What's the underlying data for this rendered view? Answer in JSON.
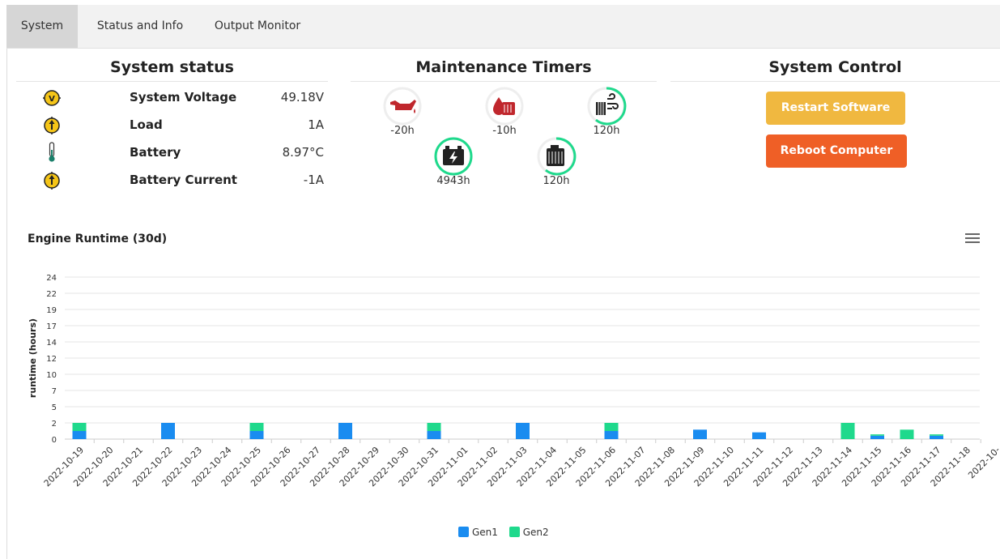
{
  "tabs": [
    {
      "label": "System",
      "active": true
    },
    {
      "label": "Status and Info",
      "active": false
    },
    {
      "label": "Output Monitor",
      "active": false
    }
  ],
  "system_status": {
    "title": "System status",
    "rows": [
      {
        "icon": "voltage-gauge-icon",
        "label": "System Voltage",
        "value": "49.18V"
      },
      {
        "icon": "current-arrow-icon",
        "label": "Load",
        "value": "1A"
      },
      {
        "icon": "thermometer-icon",
        "label": "Battery",
        "value": "8.97°C"
      },
      {
        "icon": "current-arrow-icon",
        "label": "Battery Current",
        "value": "-1A"
      }
    ]
  },
  "maintenance": {
    "title": "Maintenance Timers",
    "timers": [
      {
        "icon": "oil-can-icon",
        "value": "-20h",
        "progress": 0
      },
      {
        "icon": "coolant-drop-icon",
        "value": "-10h",
        "progress": 0
      },
      {
        "icon": "air-filter-icon",
        "value": "120h",
        "progress": 0.6
      },
      {
        "icon": "battery-icon",
        "value": "4943h",
        "progress": 1.0
      },
      {
        "icon": "fuel-filter-icon",
        "value": "120h",
        "progress": 0.6
      }
    ]
  },
  "system_control": {
    "title": "System Control",
    "restart_label": "Restart Software",
    "reboot_label": "Reboot Computer"
  },
  "colors": {
    "gen1": "#1a8cf0",
    "gen2": "#1fd98c",
    "restart": "#f0b840",
    "reboot": "#ef5f26",
    "ring": "#1fd98c",
    "icon_red": "#c0272d"
  },
  "chart_data": {
    "type": "bar",
    "title": "Engine Runtime (30d)",
    "ylabel": "runtime (hours)",
    "ylim": [
      0,
      24
    ],
    "yticks": [
      "0",
      "2",
      "5",
      "7",
      "10",
      "12",
      "14",
      "17",
      "19",
      "22",
      "24"
    ],
    "categories": [
      "2022-10-19",
      "2022-10-20",
      "2022-10-21",
      "2022-10-22",
      "2022-10-23",
      "2022-10-24",
      "2022-10-25",
      "2022-10-26",
      "2022-10-27",
      "2022-10-28",
      "2022-10-29",
      "2022-10-30",
      "2022-10-31",
      "2022-11-01",
      "2022-11-02",
      "2022-11-03",
      "2022-11-04",
      "2022-11-05",
      "2022-11-06",
      "2022-11-07",
      "2022-11-08",
      "2022-11-09",
      "2022-11-10",
      "2022-11-11",
      "2022-11-12",
      "2022-11-13",
      "2022-11-14",
      "2022-11-15",
      "2022-11-16",
      "2022-11-17",
      "2022-11-18",
      "2022-10-"
    ],
    "series": [
      {
        "name": "Gen1",
        "values": [
          1.2,
          0,
          0,
          2.4,
          0,
          0,
          1.2,
          0,
          0,
          2.4,
          0,
          0,
          1.2,
          0,
          0,
          2.4,
          0,
          0,
          1.2,
          0,
          0,
          1.4,
          0,
          1.0,
          0,
          0,
          0,
          0.5,
          0,
          0.5,
          0,
          0
        ]
      },
      {
        "name": "Gen2",
        "values": [
          1.2,
          0,
          0,
          0,
          0,
          0,
          1.2,
          0,
          0,
          0,
          0,
          0,
          1.2,
          0,
          0,
          0,
          0,
          0,
          1.2,
          0,
          0,
          0,
          0,
          0,
          0,
          0,
          2.4,
          0.2,
          1.4,
          0.2,
          0,
          0
        ]
      }
    ],
    "legend": "bottom-center",
    "grid": true
  }
}
